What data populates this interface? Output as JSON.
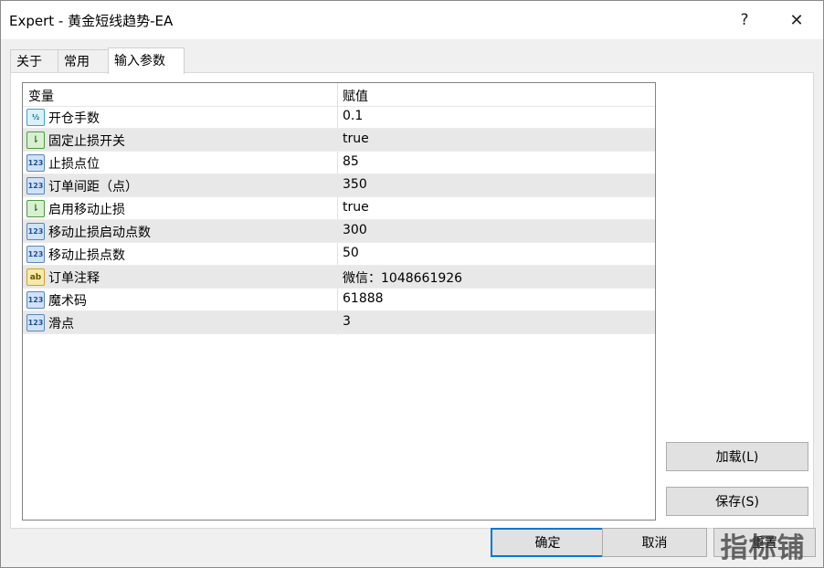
{
  "window": {
    "title": "Expert - 黄金短线趋势-EA",
    "help_label": "?",
    "close_label": "✕"
  },
  "tabs": [
    {
      "label": "关于",
      "active": false
    },
    {
      "label": "常用",
      "active": false
    },
    {
      "label": "输入参数",
      "active": true
    }
  ],
  "grid": {
    "columns": [
      "变量",
      "赋值"
    ],
    "rows": [
      {
        "icon": "fraction-icon",
        "icon_text": "½",
        "name": "开仓手数",
        "value": "0.1"
      },
      {
        "icon": "boolean-icon",
        "icon_text": "⇂",
        "name": "固定止损开关",
        "value": "true"
      },
      {
        "icon": "integer-icon",
        "icon_text": "123",
        "name": "止损点位",
        "value": "85"
      },
      {
        "icon": "integer-icon",
        "icon_text": "123",
        "name": "订单间距（点）",
        "value": "350"
      },
      {
        "icon": "boolean-icon",
        "icon_text": "⇂",
        "name": "启用移动止损",
        "value": "true"
      },
      {
        "icon": "integer-icon",
        "icon_text": "123",
        "name": "移动止损启动点数",
        "value": "300"
      },
      {
        "icon": "integer-icon",
        "icon_text": "123",
        "name": "移动止损点数",
        "value": "50"
      },
      {
        "icon": "string-icon",
        "icon_text": "ab",
        "name": "订单注释",
        "value": "微信：1048661926"
      },
      {
        "icon": "integer-icon",
        "icon_text": "123",
        "name": "魔术码",
        "value": "61888"
      },
      {
        "icon": "integer-icon",
        "icon_text": "123",
        "name": "滑点",
        "value": "3"
      }
    ]
  },
  "buttons": {
    "load": "加载(L)",
    "save": "保存(S)",
    "ok": "确定",
    "cancel": "取消",
    "reset": "重置"
  },
  "watermark": "指标铺"
}
